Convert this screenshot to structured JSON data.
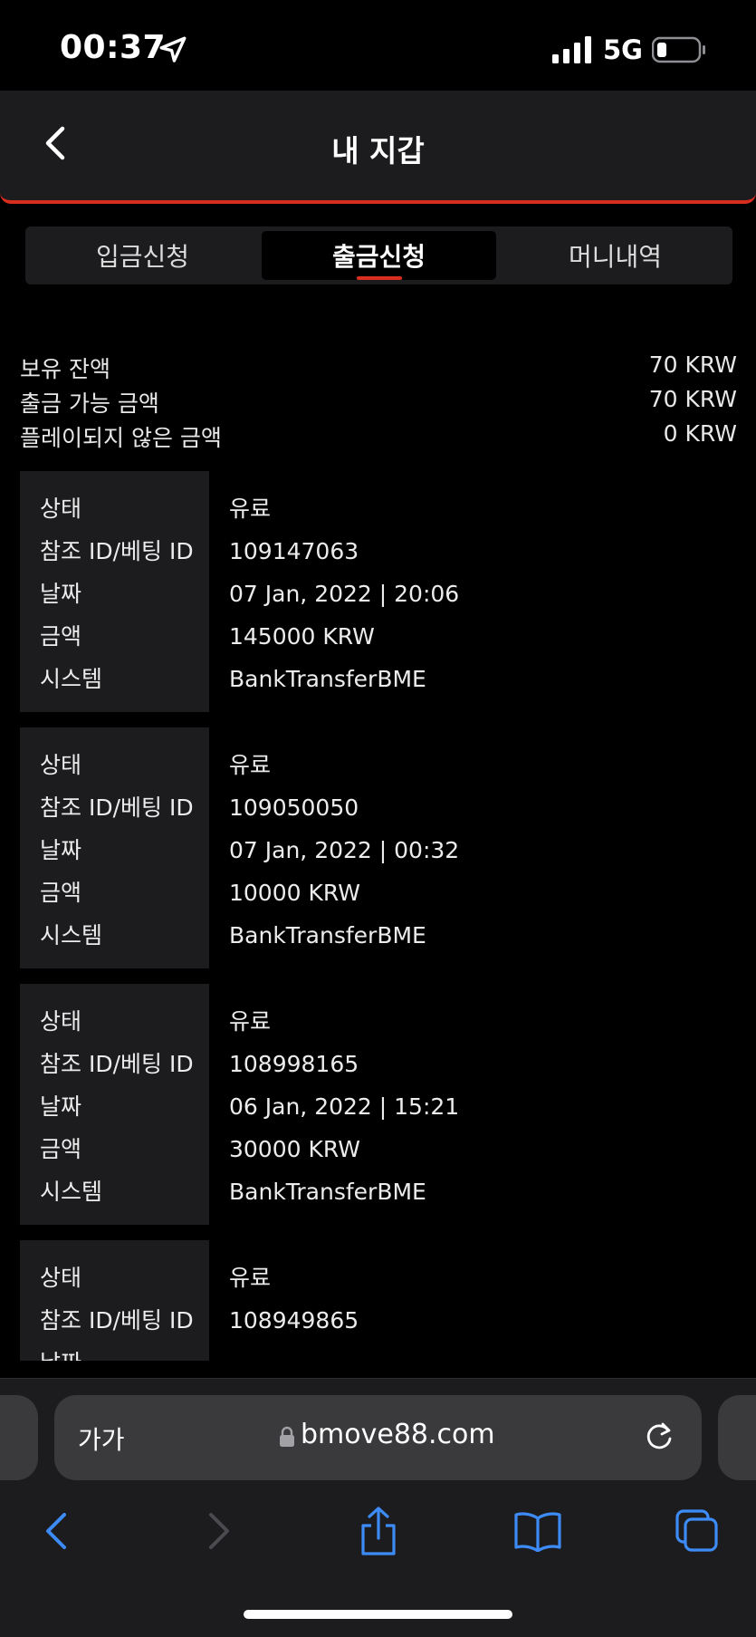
{
  "status_bar": {
    "time": "00:37",
    "network": "5G"
  },
  "header": {
    "title": "내 지갑"
  },
  "tabs": [
    {
      "label": "입금신청",
      "active": false
    },
    {
      "label": "출금신청",
      "active": true
    },
    {
      "label": "머니내역",
      "active": false
    }
  ],
  "summary": [
    {
      "label": "보유 잔액",
      "value": "70 KRW"
    },
    {
      "label": "출금 가능 금액",
      "value": "70 KRW"
    },
    {
      "label": "플레이되지 않은 금액",
      "value": "0 KRW"
    }
  ],
  "record_labels": [
    "상태",
    "참조 ID/베팅 ID",
    "날짜",
    "금액",
    "시스템"
  ],
  "records": [
    {
      "status": "유료",
      "ref_id": "109147063",
      "date": "07 Jan, 2022 | 20:06",
      "amount": "145000 KRW",
      "system": "BankTransferBME"
    },
    {
      "status": "유료",
      "ref_id": "109050050",
      "date": "07 Jan, 2022 | 00:32",
      "amount": "10000 KRW",
      "system": "BankTransferBME"
    },
    {
      "status": "유료",
      "ref_id": "108998165",
      "date": "06 Jan, 2022 | 15:21",
      "amount": "30000 KRW",
      "system": "BankTransferBME"
    },
    {
      "status": "유료",
      "ref_id": "108949865"
    }
  ],
  "browser": {
    "aa_label": "가가",
    "url": "bmove88.com"
  },
  "colors": {
    "accent": "#d92e1f",
    "ios_blue": "#3d8bf7",
    "panel": "#1c1c1e"
  }
}
